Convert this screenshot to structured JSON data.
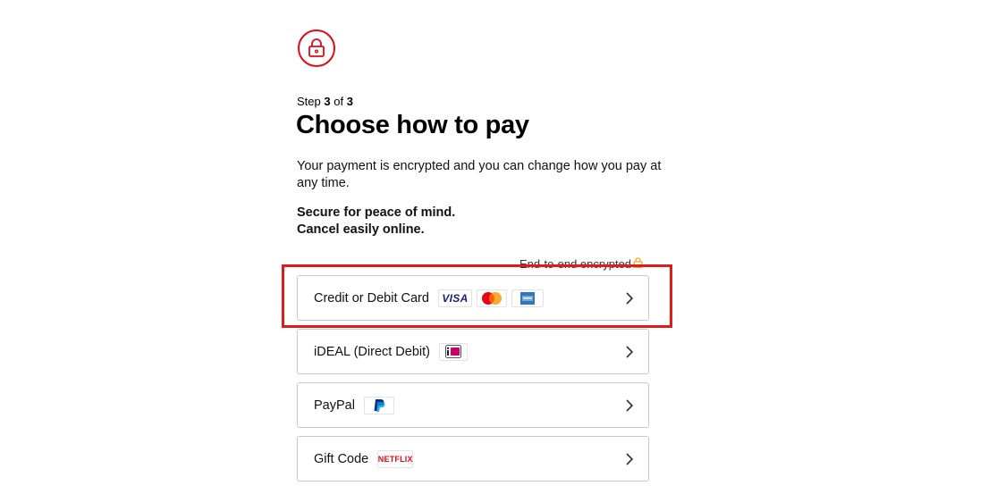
{
  "header": {
    "lock_icon": "lock-icon",
    "step_prefix": "Step",
    "step_current": "3",
    "step_of": "of",
    "step_total": "3",
    "title": "Choose how to pay",
    "description": "Your payment is encrypted and you can change how you pay at any time.",
    "secure_line1": "Secure for peace of mind.",
    "secure_line2": "Cancel easily online.",
    "encrypted_label": "End-to-end encrypted"
  },
  "options": [
    {
      "label": "Credit or Debit Card",
      "logos": [
        "VISA",
        "mastercard-logo",
        "amex-logo"
      ]
    },
    {
      "label": "iDEAL (Direct Debit)",
      "logos": [
        "ideal-logo"
      ]
    },
    {
      "label": "PayPal",
      "logos": [
        "paypal-logo"
      ]
    },
    {
      "label": "Gift Code",
      "logos": [
        "NETFLIX"
      ]
    }
  ],
  "colors": {
    "brand": "#e50914",
    "highlight": "#e01b1b",
    "mastercard_red": "#eb001b",
    "mastercard_orange": "#f79e1b",
    "visa_blue": "#1a1f71",
    "amex_blue": "#2e77bc",
    "ideal_pink": "#cc0066",
    "paypal_blue": "#003087",
    "encrypted_lock": "#f5a623"
  }
}
